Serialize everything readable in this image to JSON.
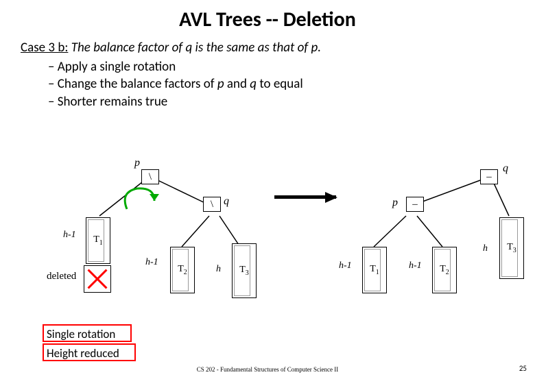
{
  "title": "AVL Trees -- Deletion",
  "case": {
    "prefix": "Case 3 b:",
    "desc": "The balance factor of q is the same as that of p."
  },
  "bullets": {
    "b1": "Apply a single rotation",
    "b2_a": "Change the balance factors of ",
    "b2_p": "p",
    "b2_mid": " and ",
    "b2_q": "q",
    "b2_end": " to equal",
    "b3": "Shorter remains true"
  },
  "left": {
    "p": "p",
    "q": "q",
    "bf_p": "\\",
    "bf_q": "\\",
    "t1": "T",
    "t1_sub": "1",
    "t2": "T",
    "t2_sub": "2",
    "t3": "T",
    "t3_sub": "3",
    "h1": "h-1",
    "h2": "h-1",
    "h3": "h",
    "deleted": "deleted"
  },
  "right": {
    "p": "p",
    "q": "q",
    "bf_p": "–",
    "bf_q": "–",
    "t1": "T",
    "t1_sub": "1",
    "t2": "T",
    "t2_sub": "2",
    "t3": "T",
    "t3_sub": "3",
    "h1": "h-1",
    "h2": "h-1",
    "h3": "h"
  },
  "notes": {
    "line1": "Single rotation",
    "line2": "Height reduced"
  },
  "footer": "CS 202 - Fundamental Structures of Computer Science II",
  "page": "25"
}
